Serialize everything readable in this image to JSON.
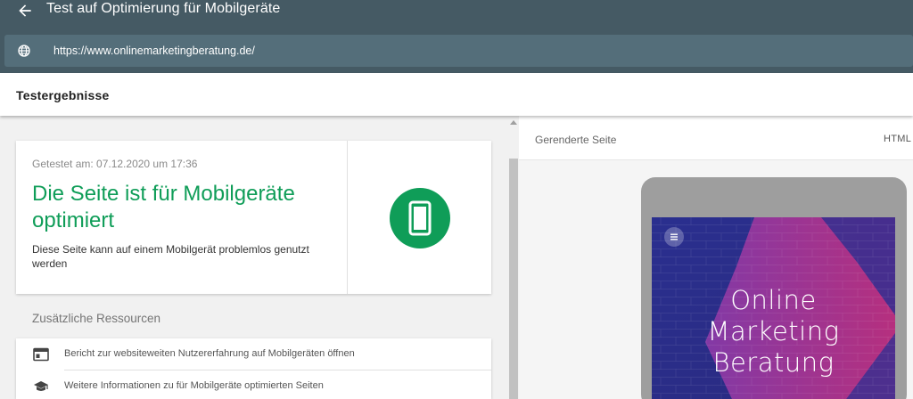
{
  "app": {
    "title": "Test auf Optimierung für Mobilgeräte",
    "url": "https://www.onlinemarketingberatung.de/"
  },
  "results_header": {
    "title": "Testergebnisse"
  },
  "result_card": {
    "tested_at": "Getestet am: 07.12.2020 um 17:36",
    "verdict": "Die Seite ist für Mobilgeräte optimiert",
    "description": "Diese Seite kann auf einem Mobilgerät problemlos genutzt werden",
    "status_icon": "smartphone-icon",
    "status_color": "#0f9d58"
  },
  "resources": {
    "title": "Zusätzliche Ressourcen",
    "items": [
      {
        "icon": "browser-window-icon",
        "label": "Bericht zur websiteweiten Nutzererfahrung auf Mobilgeräten öffnen"
      },
      {
        "icon": "graduation-cap-icon",
        "label": "Weitere Informationen zu für Mobilgeräte optimierten Seiten"
      }
    ]
  },
  "preview": {
    "tab_rendered": "Gerenderte Seite",
    "tab_html": "HTML",
    "hero_lines": [
      "Online",
      "Marketing",
      "Beratung"
    ]
  },
  "colors": {
    "header_bg": "#455a64",
    "urlbar_bg": "#546e7a",
    "accent_green": "#0f9d58"
  }
}
